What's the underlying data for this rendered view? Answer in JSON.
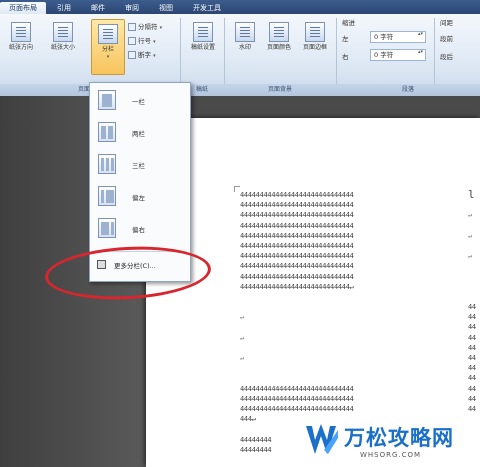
{
  "ribbon_tabs": [
    "页面布局",
    "引用",
    "邮件",
    "审阅",
    "视图",
    "开发工具"
  ],
  "ribbon": {
    "buttons": {
      "orientation": "纸张方向",
      "size": "纸张大小",
      "columns": "分栏",
      "breaks": "分隔符",
      "line_numbers": "行号",
      "hyphenation": "断字",
      "draft_paper": "稿纸设置",
      "watermark": "水印",
      "page_color": "页面颜色",
      "page_border": "页面边框"
    },
    "indent_label": "缩进",
    "spacing_label": "间距",
    "indent_left_label": "左",
    "indent_right_label": "右",
    "indent_left_value": "0 字符",
    "indent_right_value": "0 字符",
    "spacing_before": "段前",
    "spacing_after": "段后",
    "groups": {
      "page_setup": "页面设置",
      "draft": "稿纸",
      "page_background": "页面背景",
      "paragraph": "段落"
    }
  },
  "columns_menu": {
    "items": [
      "一栏",
      "两栏",
      "三栏",
      "偏左",
      "偏右"
    ],
    "more": "更多分栏(C)..."
  },
  "document": {
    "line_text": "44444444444444444444444444444",
    "para_mark": "↵",
    "short_end": "4444444444444444444444444444↵",
    "tail": "444↵",
    "bottom_lines": [
      "44444444",
      "44444444"
    ],
    "right_col": [
      "44",
      "44",
      "44",
      "44",
      "44",
      "44",
      "44",
      "44",
      "44",
      "44",
      "44"
    ],
    "right_heading": "l"
  },
  "watermark": {
    "text": "万松攻略网",
    "sub": "WHSORG.COM"
  },
  "colors": {
    "accent": "#1a6fc9",
    "annotation": "#d8262e",
    "ribbon_tab": "#2b4673"
  }
}
